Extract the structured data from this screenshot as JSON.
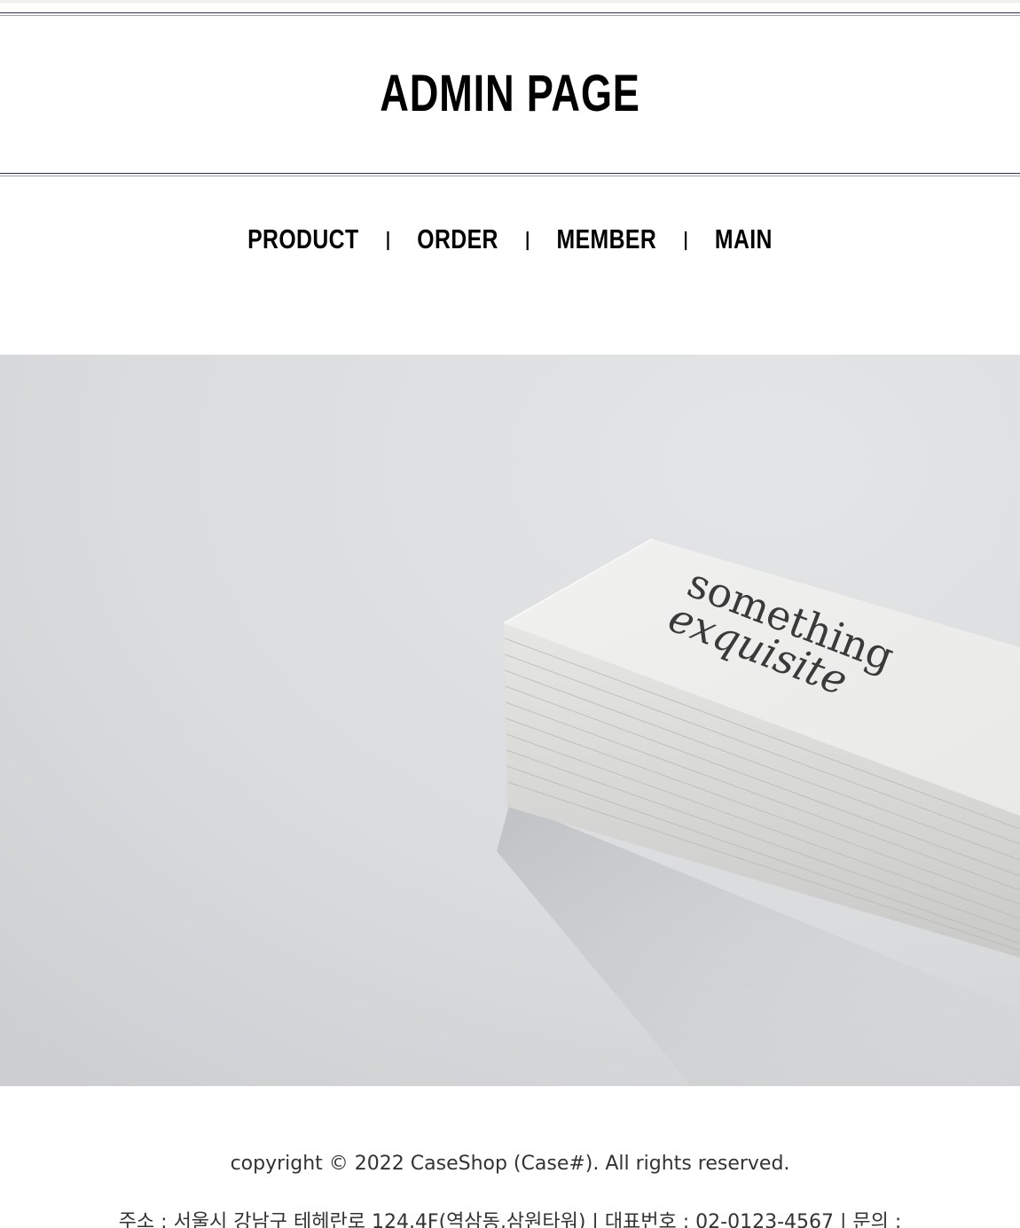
{
  "header": {
    "title": "ADMIN PAGE"
  },
  "nav": {
    "items": [
      {
        "label": "PRODUCT"
      },
      {
        "label": "ORDER"
      },
      {
        "label": "MEMBER"
      },
      {
        "label": "MAIN"
      }
    ],
    "separator": "|"
  },
  "hero": {
    "card_text_line1": "something",
    "card_text_line2": "exquisite"
  },
  "footer": {
    "copyright": "copyright © 2022 CaseShop (Case#). All rights reserved.",
    "address": "주소 : 서울시 강남구 테헤란로 124,4F(역삼동,삼원타워) | 대표번호 : 02-0123-4567 | 문의 :"
  },
  "colors": {
    "rule": "#2c2f6b",
    "text": "#000000",
    "footer_text": "#333333",
    "hero_bg": "#dfe1e3"
  }
}
